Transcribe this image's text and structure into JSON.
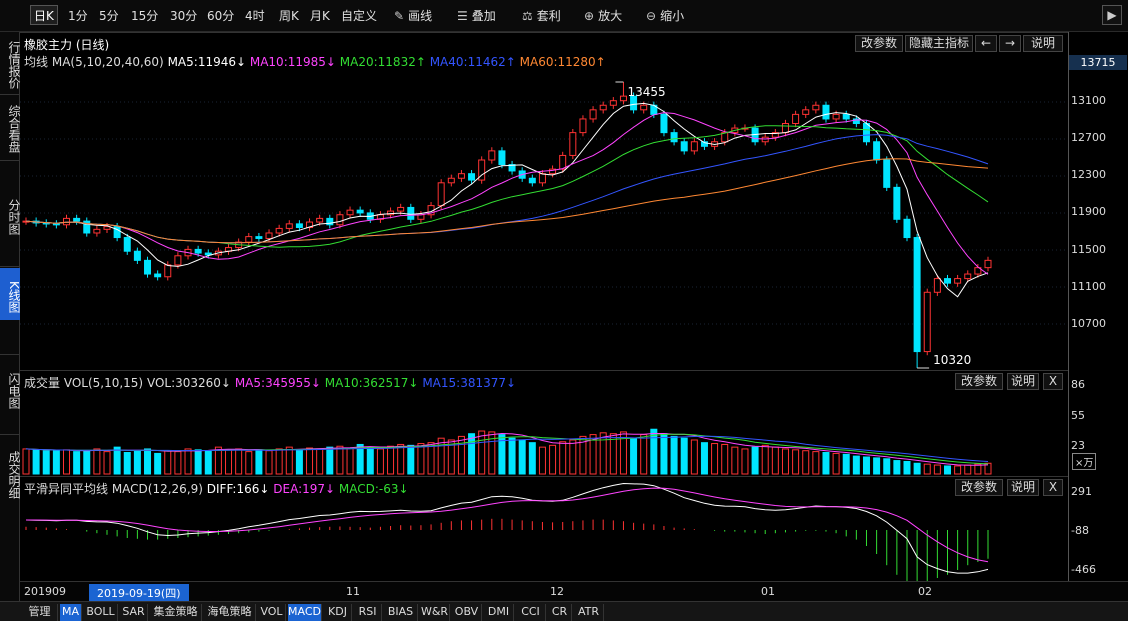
{
  "toolbar": {
    "items": [
      "日K",
      "1分",
      "5分",
      "15分",
      "30分",
      "60分",
      "4时",
      "周K",
      "月K",
      "自定义",
      "画线",
      "叠加",
      "套利",
      "放大",
      "缩小"
    ],
    "active": "日K"
  },
  "leftnav": [
    "行情报价",
    "综合看盘",
    "分时图",
    "K线图",
    "闪电图",
    "成交明细"
  ],
  "main_panel": {
    "title": "橡胶主力 (日线)",
    "ma_label": "均线",
    "ma_params": "MA(5,10,20,40,60)",
    "ma_values": [
      {
        "t": "MA5:11946↓",
        "c": "#ffffff"
      },
      {
        "t": "MA10:11985↓",
        "c": "#ff44ff"
      },
      {
        "t": "MA20:11832↑",
        "c": "#33dd33"
      },
      {
        "t": "MA40:11462↑",
        "c": "#3355ff"
      },
      {
        "t": "MA60:11280↑",
        "c": "#ff8833"
      }
    ],
    "buttons": [
      "改参数",
      "隐藏主指标",
      "←",
      "→",
      "说明"
    ],
    "high_label": "13455",
    "low_label": "10320",
    "price_box": "13715"
  },
  "vol_panel": {
    "title": "成交量 VOL(5,10,15)",
    "vol": "VOL:303260↓",
    "ma_values": [
      {
        "t": "MA5:345955↓",
        "c": "#ff44ff"
      },
      {
        "t": "MA10:362517↓",
        "c": "#33dd33"
      },
      {
        "t": "MA15:381377↓",
        "c": "#3355ff"
      }
    ],
    "buttons": [
      "改参数",
      "说明",
      "X"
    ]
  },
  "macd_panel": {
    "title": "平滑异同平均线 MACD(12,26,9)",
    "diff": "DIFF:166↓",
    "dea": "DEA:197↓",
    "macd": "MACD:-63↓",
    "buttons": [
      "改参数",
      "说明",
      "X"
    ]
  },
  "axis": {
    "price_ticks": [
      "13100",
      "12700",
      "12300",
      "11900",
      "11500",
      "11100",
      "10700"
    ],
    "vol_ticks": [
      "86",
      "55",
      "23"
    ],
    "vol_unit": "×万",
    "macd_ticks": [
      "291",
      "-88",
      "-466"
    ]
  },
  "dates": {
    "start": "201909",
    "selected": "2019-09-19(四)",
    "months": [
      "11",
      "12",
      "01",
      "02"
    ]
  },
  "tabs": [
    "管理",
    "MA",
    "BOLL",
    "SAR",
    "集金策略",
    "海龟策略",
    "VOL",
    "MACD",
    "KDJ",
    "RSI",
    "BIAS",
    "W&R",
    "OBV",
    "DMI",
    "CCI",
    "CR",
    "ATR"
  ],
  "active_tabs": [
    "MA",
    "MACD"
  ],
  "colors": {
    "up": "#ff3333",
    "down": "#00e5ff",
    "ma5": "#ffffff",
    "ma10": "#ff44ff",
    "ma20": "#33dd33",
    "ma40": "#3355ff",
    "ma60": "#ff8833",
    "dea": "#ff44ff"
  },
  "chart_data": {
    "type": "candlestick",
    "series_desc": "daily candles",
    "closes": [
      11930,
      11910,
      11900,
      11890,
      11960,
      11930,
      11800,
      11840,
      11870,
      11750,
      11600,
      11500,
      11350,
      11320,
      11450,
      11550,
      11620,
      11580,
      11560,
      11600,
      11640,
      11700,
      11760,
      11740,
      11800,
      11850,
      11900,
      11860,
      11920,
      11960,
      11890,
      12000,
      12050,
      12020,
      11950,
      12000,
      12040,
      12080,
      11950,
      12000,
      12100,
      12350,
      12400,
      12450,
      12380,
      12600,
      12700,
      12550,
      12480,
      12400,
      12350,
      12450,
      12500,
      12650,
      12900,
      13050,
      13150,
      13200,
      13250,
      13300,
      13150,
      13200,
      13100,
      12900,
      12800,
      12700,
      12800,
      12750,
      12800,
      12900,
      12950,
      12950,
      12800,
      12850,
      12900,
      13000,
      13100,
      13150,
      13200,
      13050,
      13100,
      13050,
      13000,
      12800,
      12600,
      12300,
      11950,
      11750,
      10500,
      11150,
      11300,
      11250,
      11300,
      11350,
      11420,
      11500
    ]
  },
  "volumes": [
    28,
    27,
    26,
    26,
    27,
    25,
    26,
    28,
    25,
    30,
    24,
    26,
    28,
    23,
    26,
    25,
    28,
    27,
    26,
    30,
    27,
    28,
    25,
    27,
    26,
    28,
    30,
    27,
    29,
    28,
    30,
    31,
    29,
    33,
    30,
    28,
    31,
    33,
    32,
    34,
    35,
    40,
    38,
    42,
    45,
    48,
    47,
    44,
    40,
    38,
    35,
    30,
    32,
    36,
    38,
    42,
    44,
    46,
    45,
    47,
    40,
    44,
    50,
    45,
    42,
    40,
    38,
    35,
    34,
    33,
    30,
    28,
    30,
    32,
    30,
    28,
    27,
    26,
    25,
    24,
    23,
    22,
    20,
    19,
    18,
    17,
    15,
    14,
    12,
    11,
    10,
    9,
    9,
    10,
    11,
    12
  ],
  "macd_hist": [
    20,
    18,
    15,
    10,
    5,
    0,
    -10,
    -20,
    -30,
    -40,
    -50,
    -55,
    -60,
    -60,
    -55,
    -50,
    -45,
    -40,
    -35,
    -30,
    -25,
    -20,
    -15,
    -10,
    -5,
    0,
    5,
    10,
    15,
    18,
    20,
    22,
    20,
    18,
    15,
    20,
    25,
    30,
    28,
    30,
    35,
    45,
    55,
    60,
    60,
    65,
    70,
    70,
    65,
    60,
    55,
    50,
    48,
    50,
    55,
    60,
    65,
    65,
    60,
    55,
    45,
    40,
    35,
    25,
    15,
    10,
    5,
    0,
    -5,
    -10,
    -10,
    -15,
    -20,
    -25,
    -20,
    -15,
    -10,
    -5,
    -5,
    -10,
    -20,
    -40,
    -60,
    -100,
    -150,
    -220,
    -280,
    -330,
    -350,
    -330,
    -300,
    -280,
    -250,
    -220,
    -200,
    -180
  ]
}
